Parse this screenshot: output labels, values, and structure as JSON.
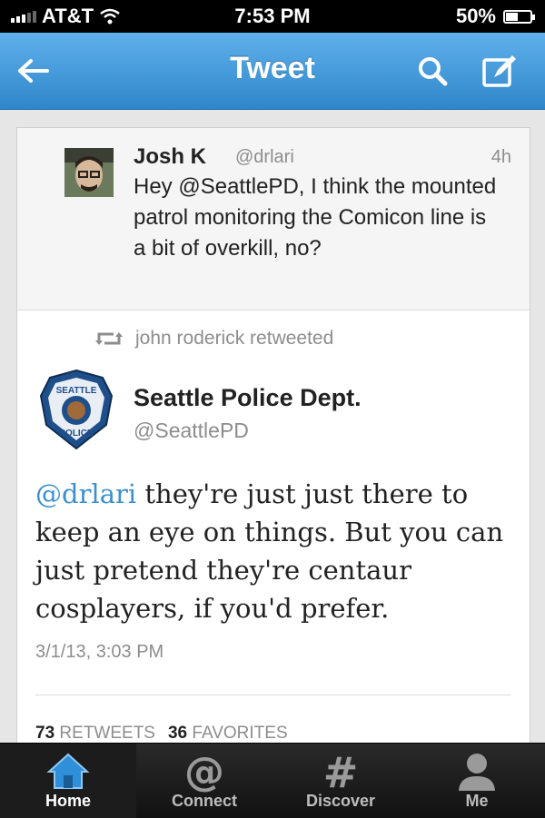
{
  "status_bar": {
    "carrier": "AT&T",
    "time": "7:53 PM",
    "battery": "50%",
    "battery_level": 0.5
  },
  "navbar": {
    "title": "Tweet"
  },
  "reply_tweet": {
    "name": "Josh K",
    "handle": "@drlari",
    "time": "4h",
    "text": "Hey @SeattlePD, I think the mounted patrol monitoring the Comicon line is a bit of overkill, no?"
  },
  "retweet_notice": "john roderick retweeted",
  "main_tweet": {
    "name": "Seattle Police Dept.",
    "handle": "@SeattlePD",
    "badge_top": "SEATTLE",
    "badge_bottom": "POLICE",
    "mention": "@drlari",
    "text": " they're just just there to keep an eye on things. But you can just pretend they're centaur cosplayers, if you'd prefer.",
    "date": "3/1/13, 3:03 PM"
  },
  "stats": {
    "retweets_count": "73",
    "retweets_label": "RETWEETS",
    "favorites_count": "36",
    "favorites_label": "FAVORITES"
  },
  "tabs": [
    {
      "label": "Home",
      "icon": "home-icon"
    },
    {
      "label": "Connect",
      "icon": "at-icon"
    },
    {
      "label": "Discover",
      "icon": "hash-icon"
    },
    {
      "label": "Me",
      "icon": "person-icon"
    }
  ],
  "colors": {
    "navbar": "#3b95d8",
    "link": "#3a8fd1",
    "tab_active": "#2f8fd8"
  }
}
